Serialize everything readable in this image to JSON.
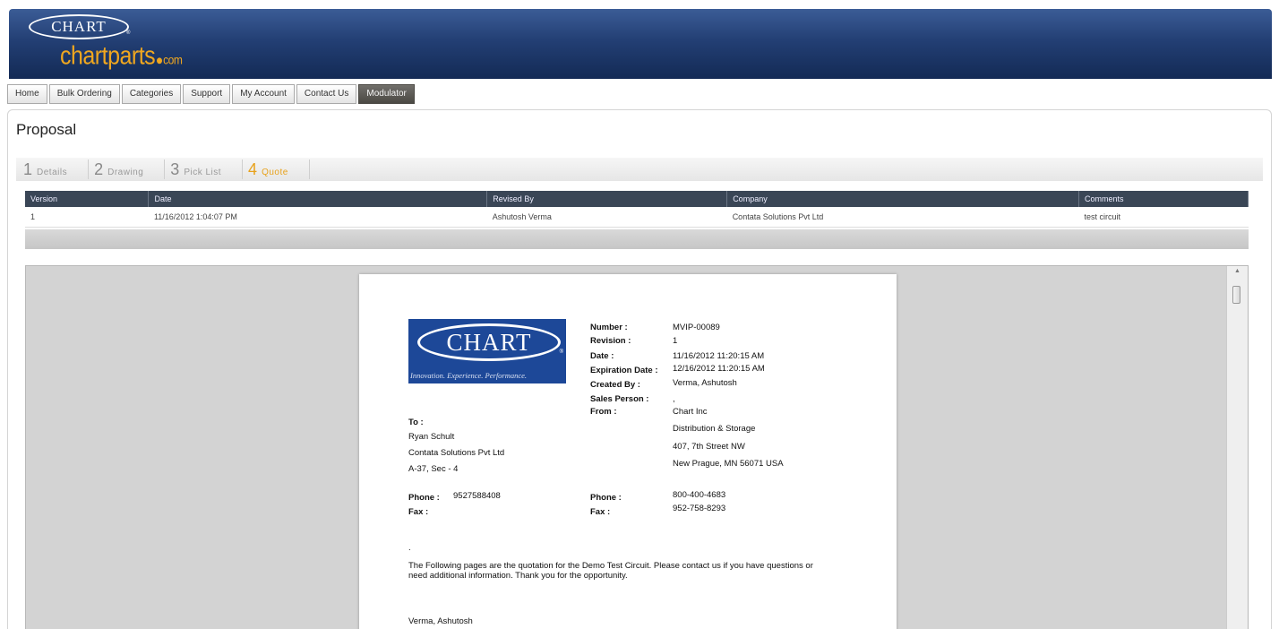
{
  "brand": {
    "logo_text": "CHART",
    "reg": "®",
    "site_name": "chartparts",
    "site_suffix": "com"
  },
  "nav": {
    "tabs": [
      "Home",
      "Bulk Ordering",
      "Categories",
      "Support",
      "My Account",
      "Contact Us",
      "Modulator"
    ],
    "active": "Modulator"
  },
  "page": {
    "title": "Proposal"
  },
  "steps": [
    {
      "num": "1",
      "label": "Details"
    },
    {
      "num": "2",
      "label": "Drawing"
    },
    {
      "num": "3",
      "label": "Pick List"
    },
    {
      "num": "4",
      "label": "Quote",
      "current": true
    }
  ],
  "version_table": {
    "headers": [
      "Version",
      "Date",
      "Revised By",
      "Company",
      "Comments"
    ],
    "rows": [
      [
        "1",
        "11/16/2012 1:04:07 PM",
        "Ashutosh Verma",
        "Contata Solutions Pvt Ltd",
        "test circuit"
      ]
    ]
  },
  "document": {
    "logo_text": "CHART",
    "logo_tagline": "Innovation. Experience. Performance.",
    "logo_reg": "®",
    "fields": {
      "number_label": "Number :",
      "number": "MVIP-00089",
      "revision_label": "Revision :",
      "revision": "1",
      "date_label": "Date :",
      "date": "11/16/2012 11:20:15 AM",
      "expiration_label": "Expiration Date :",
      "expiration": "12/16/2012 11:20:15 AM",
      "created_by_label": "Created By :",
      "created_by": "Verma, Ashutosh",
      "sales_person_label": "Sales Person :",
      "sales_person": ",",
      "from_label": "From :"
    },
    "to": {
      "label": "To :",
      "lines": [
        "Ryan Schult",
        "Contata Solutions Pvt Ltd",
        "A-37, Sec - 4"
      ],
      "phone_label": "Phone :",
      "phone": "9527588408",
      "fax_label": "Fax :"
    },
    "from": {
      "lines": [
        "Chart Inc",
        "Distribution & Storage",
        "407, 7th Street NW",
        "New Prague, MN 56071 USA"
      ],
      "phone_label": "Phone :",
      "phone": "800-400-4683",
      "fax_label": "Fax :",
      "fax": "952-758-8293"
    },
    "dot": ".",
    "body": "The Following pages are the quotation for the Demo Test Circuit. Please contact us if you have questions or need additional information. Thank you for the opportunity.",
    "signature": "Verma, Ashutosh"
  }
}
